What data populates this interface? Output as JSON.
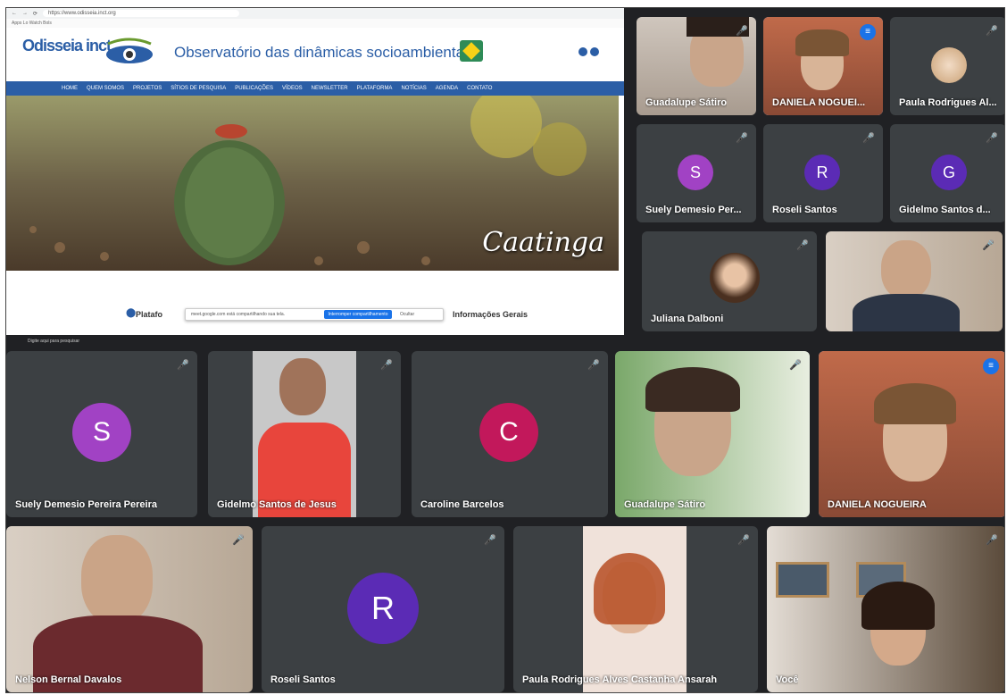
{
  "share": {
    "browser_url": "https://www.odisseia.inct.org",
    "bookmarks": "Apps   Lo Watch   Bols",
    "logo_text": "Odisseia inct",
    "site_title": "Observatório das dinâmicas socioambientais",
    "nav": [
      "HOME",
      "QUEM SOMOS",
      "PROJETOS",
      "SÍTIOS DE PESQUISA",
      "PUBLICAÇÕES",
      "VÍDEOS",
      "NEWSLETTER",
      "PLATAFORMA",
      "NOTÍCIAS",
      "AGENDA",
      "CONTATO"
    ],
    "hero_caption": "Caatinga",
    "platform_label": "Platafo",
    "info_label": "Informações Gerais",
    "share_notice": "meet.google.com está compartilhando sua tela.",
    "stop_sharing": "Interromper compartilhamento",
    "hide": "Ocultar",
    "taskbar_search": "Digite aqui para pesquisar"
  },
  "participants": [
    {
      "id": "top-guadalupe",
      "name": "Guadalupe Sátiro",
      "type": "video",
      "muted": true
    },
    {
      "id": "top-daniela",
      "name": "DANIELA NOGUEI...",
      "type": "video",
      "speaking": true
    },
    {
      "id": "top-paula",
      "name": "Paula Rodrigues Al...",
      "type": "photo",
      "muted": true
    },
    {
      "id": "top-suely",
      "name": "Suely Demesio Per...",
      "type": "letter",
      "letter": "S",
      "color": "#a142c4",
      "muted": true
    },
    {
      "id": "top-roseli",
      "name": "Roseli Santos",
      "type": "letter",
      "letter": "R",
      "color": "#5b2bb5",
      "muted": true
    },
    {
      "id": "top-gidelmo",
      "name": "Gidelmo Santos d...",
      "type": "letter",
      "letter": "G",
      "color": "#5b2bb5",
      "muted": true
    },
    {
      "id": "top-juliana",
      "name": "Juliana Dalboni",
      "type": "photo",
      "muted": true
    },
    {
      "id": "top-nelson",
      "name": "",
      "type": "video",
      "muted": true
    },
    {
      "id": "mid-suely",
      "name": "Suely Demesio Pereira Pereira",
      "type": "letter",
      "letter": "S",
      "color": "#a142c4",
      "muted": true
    },
    {
      "id": "mid-gidelmo",
      "name": "Gidelmo Santos de Jesus",
      "type": "video",
      "muted": true
    },
    {
      "id": "mid-caroline",
      "name": "Caroline Barcelos",
      "type": "letter",
      "letter": "C",
      "color": "#c2185b",
      "muted": true
    },
    {
      "id": "mid-guadalupe",
      "name": "Guadalupe Sátiro",
      "type": "video",
      "muted": true
    },
    {
      "id": "mid-daniela",
      "name": "DANIELA NOGUEIRA",
      "type": "video",
      "speaking": true
    },
    {
      "id": "bot-nelson",
      "name": "Nelson Bernal Davalos",
      "type": "video",
      "muted": true
    },
    {
      "id": "bot-roseli",
      "name": "Roseli Santos",
      "type": "letter",
      "letter": "R",
      "color": "#5b2bb5",
      "muted": true
    },
    {
      "id": "bot-paula",
      "name": "Paula Rodrigues Alves Castanha Ansarah",
      "type": "video",
      "muted": true
    },
    {
      "id": "bot-voce",
      "name": "Você",
      "type": "video",
      "muted": true
    }
  ],
  "icons": {
    "mic_off": "🎤",
    "speaking": "▮▮▮"
  }
}
